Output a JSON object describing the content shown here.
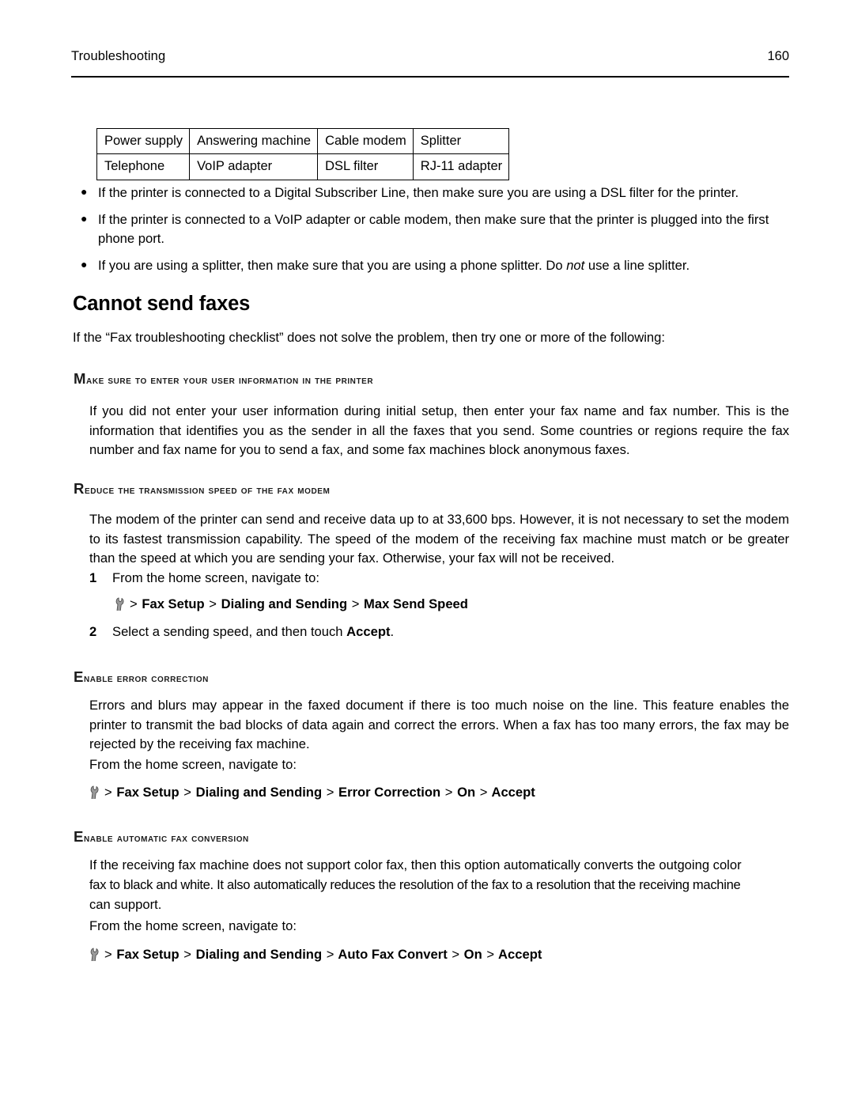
{
  "header": {
    "section": "Troubleshooting",
    "page_number": "160"
  },
  "equipment_table": {
    "rows": [
      [
        "Power supply",
        "Answering machine",
        "Cable modem",
        "Splitter"
      ],
      [
        "Telephone",
        "VoIP adapter",
        "DSL filter",
        "RJ-11 adapter"
      ]
    ]
  },
  "bullets": [
    {
      "text_before": "If the printer is connected to a Digital Subscriber Line, then make sure you are using a DSL filter for the printer.",
      "italic": "",
      "text_after": ""
    },
    {
      "text_before": "If the printer is connected to a VoIP adapter or cable modem, then make sure that the printer is plugged into the first phone port.",
      "italic": "",
      "text_after": ""
    },
    {
      "text_before": "If you are using a splitter, then make sure that you are using a phone splitter. Do ",
      "italic": "not",
      "text_after": " use a line splitter."
    }
  ],
  "section": {
    "title": "Cannot send faxes",
    "intro": "If the “Fax troubleshooting checklist” does not solve the problem, then try one or more of the following:"
  },
  "subsections": {
    "user_info": {
      "heading": "Make sure to enter your user information in the printer",
      "paragraph": "If you did not enter your user information during initial setup, then enter your fax name and fax number. This is the information that identifies you as the sender in all the faxes that you send. Some countries or regions require the fax number and fax name for you to send a fax, and some fax machines block anonymous faxes."
    },
    "reduce_speed": {
      "heading": "Reduce the transmission speed of the fax modem",
      "paragraph": "The modem of the printer can send and receive data up to at 33,600 bps. However, it is not necessary to set the modem to its fastest transmission capability. The speed of the modem of the receiving fax machine must match or be greater than the speed at which you are sending your fax. Otherwise, your fax will not be received.",
      "steps": [
        {
          "number": "1",
          "text": "From the home screen, navigate to:",
          "bold_tail": ""
        },
        {
          "number": "2",
          "text": "Select a sending speed, and then touch ",
          "bold_tail": "Accept",
          "text_end": "."
        }
      ],
      "nav_path": {
        "icon": "wrench-icon",
        "items": [
          "Fax Setup",
          "Dialing and Sending",
          "Max Send Speed"
        ],
        "separator": ">"
      }
    },
    "error_correction": {
      "heading": "Enable error correction",
      "paragraph": "Errors and blurs may appear in the faxed document if there is too much noise on the line. This feature enables the printer to transmit the bad blocks of data again and correct the errors. When a fax has too many errors, the fax may be rejected by the receiving fax machine.",
      "navigate_label": "From the home screen, navigate to:",
      "nav_path": {
        "icon": "wrench-icon",
        "items": [
          "Fax Setup",
          "Dialing and Sending",
          "Error Correction",
          "On",
          "Accept"
        ],
        "separator": ">"
      }
    },
    "auto_conversion": {
      "heading": "Enable automatic fax conversion",
      "paragraph_line1": "If the receiving fax machine does not support color fax, then this option automatically converts the outgoing color",
      "paragraph_line2": "fax to black and white. It also automatically reduces the resolution of the fax to a resolution that the receiving machine",
      "paragraph_line3": "can support.",
      "navigate_label": "From the home screen, navigate to:",
      "nav_path": {
        "icon": "wrench-icon",
        "items": [
          "Fax Setup",
          "Dialing and Sending",
          "Auto Fax Convert",
          "On",
          "Accept"
        ],
        "separator": ">"
      }
    }
  }
}
